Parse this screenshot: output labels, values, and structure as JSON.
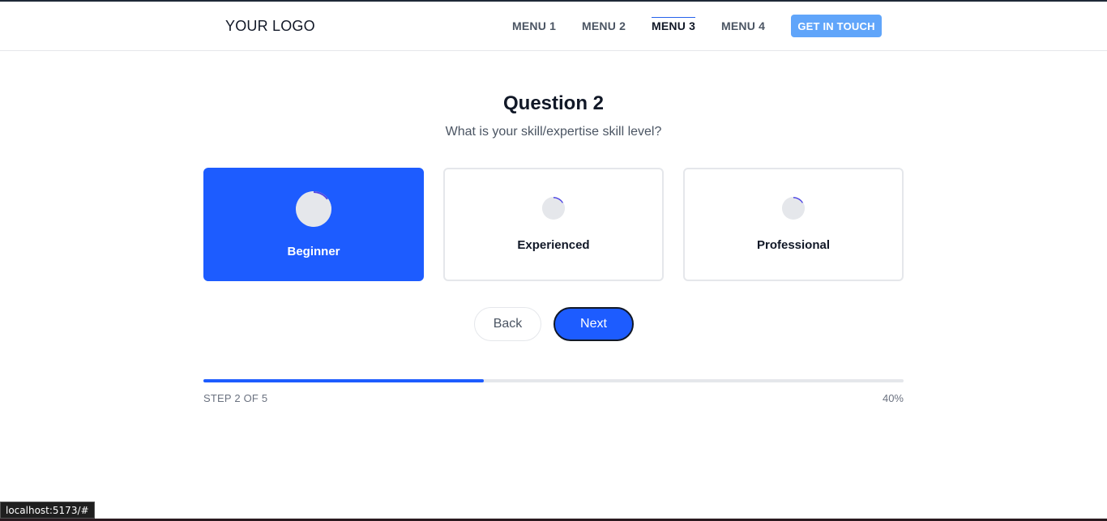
{
  "header": {
    "logo": "YOUR LOGO",
    "menu": [
      "MENU 1",
      "MENU 2",
      "MENU 3",
      "MENU 4"
    ],
    "active_menu": "MENU 3",
    "cta": "GET IN TOUCH"
  },
  "question": {
    "title": "Question 2",
    "subtitle": "What is your skill/expertise skill level?"
  },
  "options": [
    {
      "label": "Beginner",
      "icon": "spinner-icon",
      "selected": true
    },
    {
      "label": "Experienced",
      "icon": "spinner-icon",
      "selected": false
    },
    {
      "label": "Professional",
      "icon": "spinner-icon",
      "selected": false
    }
  ],
  "buttons": {
    "back": "Back",
    "next": "Next"
  },
  "progress": {
    "step_text": "STEP 2 OF 5",
    "percent_text": "40%",
    "fraction": 0.4
  },
  "status_bar": {
    "url": "localhost:5173/#"
  },
  "colors": {
    "primary": "#1d5cff",
    "cta": "#60a5fa",
    "spinner_accent": "#4f46e5"
  }
}
